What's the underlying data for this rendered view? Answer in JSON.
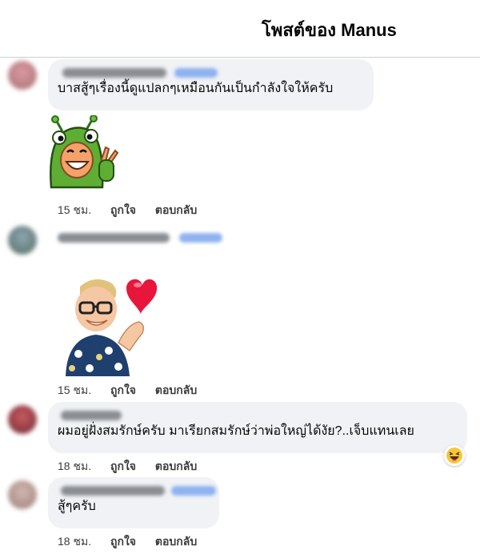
{
  "header": {
    "title": "โพสต์ของ Manus"
  },
  "comments": [
    {
      "text": "บาสสู้ๆเรื่องนี้ดูแปลกๆเหมือนกันเป็นกำลังใจให้ครับ",
      "sticker": "green-monster-thumbs-up-sticker",
      "time": "15 ชม.",
      "like": "ถูกใจ",
      "reply": "ตอบกลับ"
    },
    {
      "text": "",
      "sticker": "memoji-heart-sticker",
      "time": "15 ชม.",
      "like": "ถูกใจ",
      "reply": "ตอบกลับ"
    },
    {
      "text": "ผมอยู่ฝั่งสมรักษ์ครับ มาเรียกสมรักษ์ว่าพ่อใหญ่ได้งัย?..เจ็บแทนเลย",
      "reaction": "haha-icon",
      "time": "18 ชม.",
      "like": "ถูกใจ",
      "reply": "ตอบกลับ"
    },
    {
      "text": "สู้ๆครับ",
      "time": "18 ชม.",
      "like": "ถูกใจ",
      "reply": "ตอบกลับ"
    }
  ],
  "colors": {
    "bubble": "#f0f2f5",
    "accent_badge": "#8fb2f0",
    "heart": "#e8163b",
    "monster_green": "#5fae34"
  }
}
